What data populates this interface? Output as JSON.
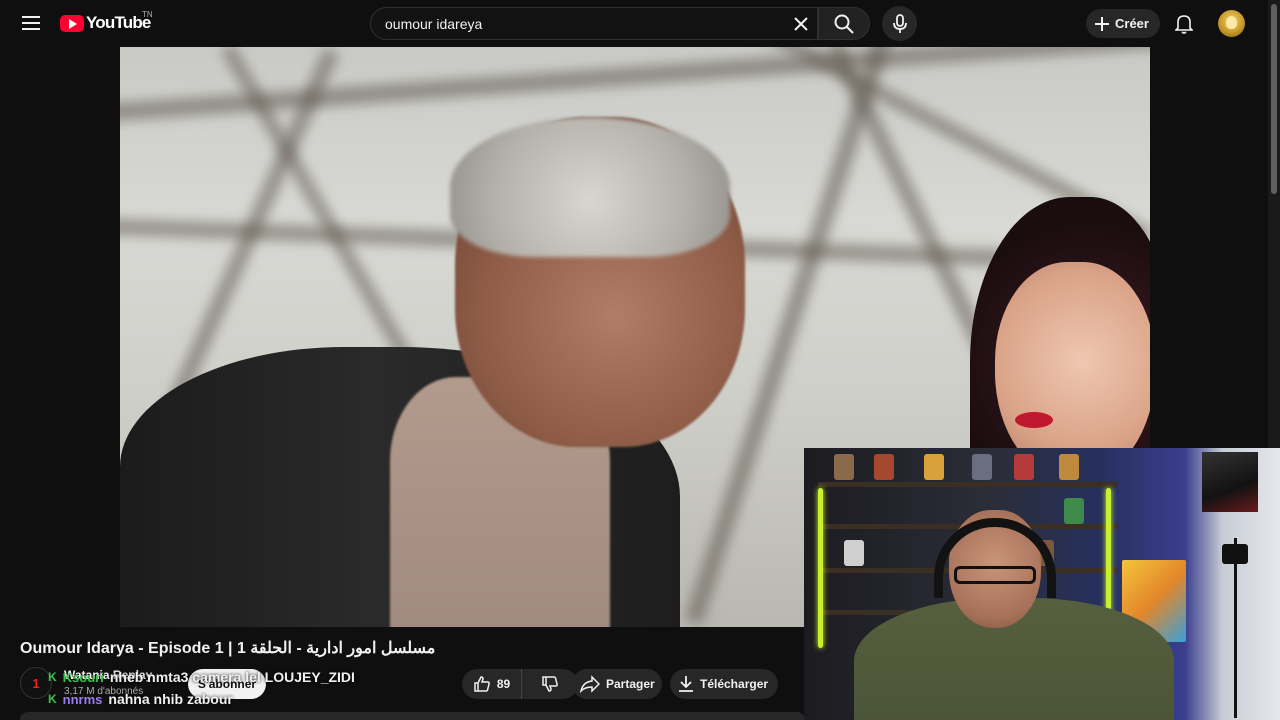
{
  "topbar": {
    "logo_text": "YouTube",
    "country_code": "TN",
    "search_value": "oumour idareya",
    "create_label": "Créer"
  },
  "video": {
    "title": "Oumour Idarya - Episode 1 | مسلسل امور ادارية - الحلقة 1"
  },
  "channel": {
    "avatar_text": "1",
    "name": "Watania Replay",
    "subscribers": "3,17 M d'abonnés",
    "subscribe_label": "S'abonner"
  },
  "chat": [
    {
      "badge": "K",
      "user": "Ksouri",
      "user_color": "#3ac24b",
      "message": "nheb nmta3 camera lel LOUJEY_ZIDI"
    },
    {
      "badge": "K",
      "user": "nnrms",
      "user_color": "#9b7cf0",
      "message": "nahna nhib zabour"
    }
  ],
  "actions": {
    "like_count": "89",
    "share_label": "Partager",
    "download_label": "Télécharger"
  },
  "icons": {
    "menu": "hamburger-icon",
    "clear": "close-icon",
    "search": "search-icon",
    "mic": "microphone-icon",
    "create": "plus-icon",
    "bell": "bell-icon",
    "like": "thumbs-up-icon",
    "dislike": "thumbs-down-icon",
    "share": "share-icon",
    "download": "download-icon"
  },
  "colors": {
    "brand_red": "#ff0033",
    "background": "#0f0f0f",
    "pill": "#272727"
  }
}
